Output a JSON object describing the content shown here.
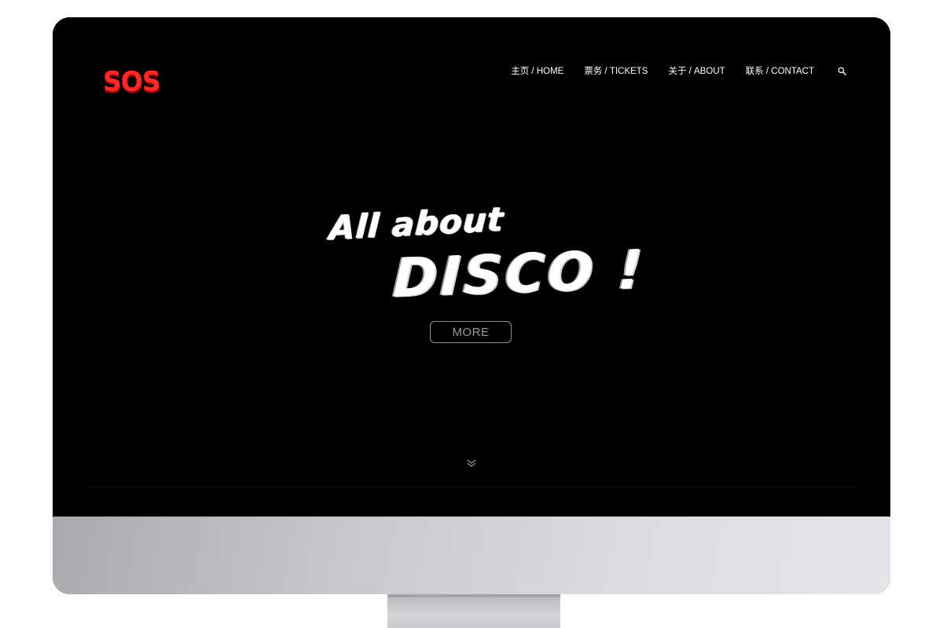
{
  "header": {
    "logo_text": "SOS",
    "nav": [
      {
        "label": "主页 / HOME"
      },
      {
        "label": "票务 / TICKETS"
      },
      {
        "label": "关于 / ABOUT"
      },
      {
        "label": "联系 / CONTACT"
      }
    ],
    "search_icon": "search-icon"
  },
  "hero": {
    "line1": "All about",
    "line2": "DISCO !",
    "button_label": "MORE",
    "scroll_icon": "chevron-double-down-icon"
  },
  "colors": {
    "logo": "#ff2a2a",
    "background": "#000000",
    "text": "#ffffff",
    "button_border": "#8e8e8e"
  }
}
